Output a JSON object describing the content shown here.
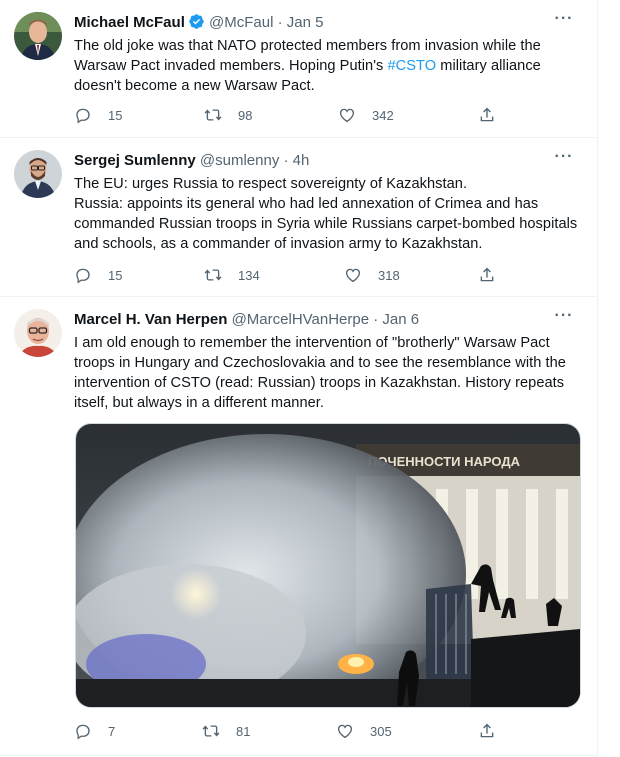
{
  "tweets": [
    {
      "name": "Michael McFaul",
      "handle": "@McFaul",
      "dot": "·",
      "time": "Jan 5",
      "text_before": "The old joke was that NATO protected members from invasion while the Warsaw Pact invaded members. Hoping Putin's ",
      "hashtag": "#CSTO",
      "text_after": " military alliance doesn't become a new Warsaw Pact.",
      "replies": "15",
      "retweets": "98",
      "likes": "342",
      "verified": true
    },
    {
      "name": "Sergej Sumlenny",
      "handle": "@sumlenny",
      "dot": "·",
      "time": "4h",
      "line1": "The EU: urges Russia to respect sovereignty of Kazakhstan.",
      "line2": "Russia: appoints its general who had led annexation of Crimea and has commanded Russian troops in Syria while Russians carpet-bombed hospitals and schools, as a commander of invasion army to Kazakhstan.",
      "replies": "15",
      "retweets": "134",
      "likes": "318"
    },
    {
      "name": "Marcel H. Van Herpen",
      "handle": "@MarcelHVanHerpe",
      "dot": "·",
      "time": "Jan 6",
      "text": "I am old enough to remember the intervention of \"brotherly\" Warsaw Pact troops in Hungary and Czechoslovakia and to see the resemblance with the intervention of CSTO (read: Russian) troops in Kazakhstan. History repeats itself, but always in a different manner.",
      "photo_sign_text": "ПОЧЕННОСТИ НАРОДА",
      "replies": "7",
      "retweets": "81",
      "likes": "305"
    }
  ],
  "colors": {
    "text": "#0f1419",
    "muted": "#536471",
    "link": "#1d9bf0",
    "border": "#eff3f4"
  },
  "icons": [
    "reply-icon",
    "retweet-icon",
    "like-icon",
    "share-icon",
    "more-icon",
    "verified-badge-icon"
  ]
}
